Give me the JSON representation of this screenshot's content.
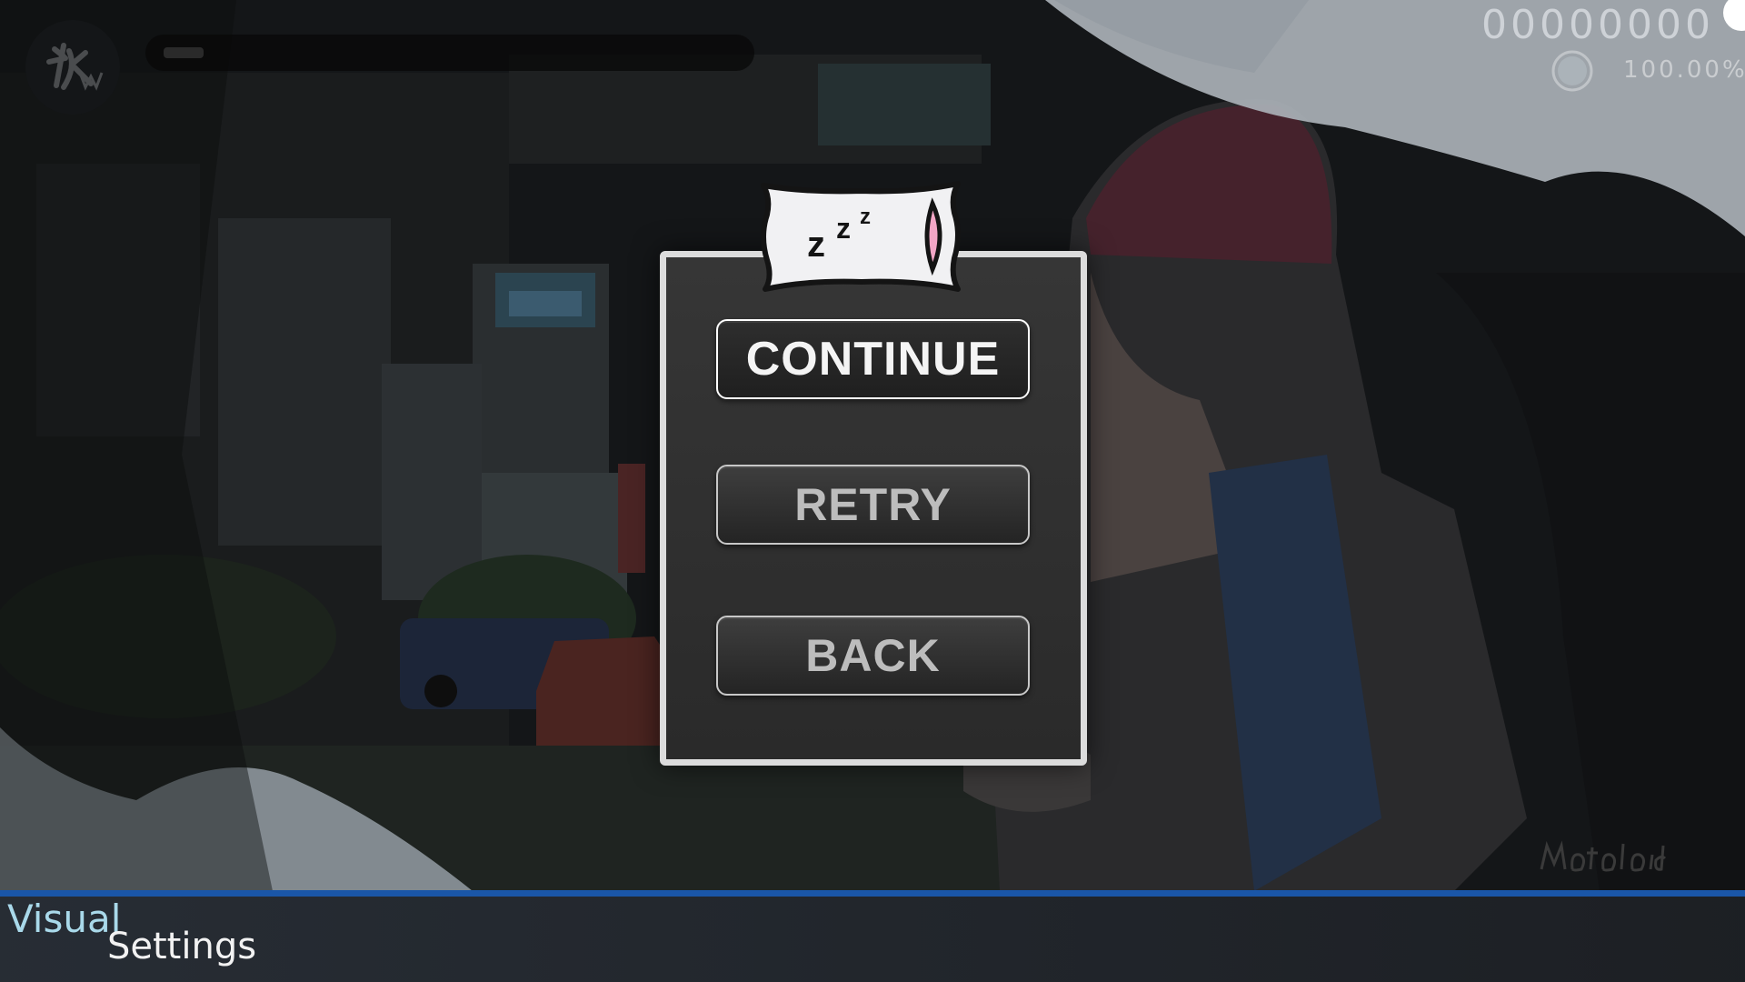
{
  "hud": {
    "logo_icon": "kw-brush-logo",
    "progress": 0.07,
    "score": "00000000",
    "accuracy": "100.00%",
    "accuracy_pie": 1.0
  },
  "pause_menu": {
    "header_icon": "sleeping-pillow-zzz-icon",
    "buttons": {
      "continue": "CONTINUE",
      "retry": "RETRY",
      "back": "BACK"
    }
  },
  "footer": {
    "visual_label": "Visual",
    "settings_label": "Settings"
  },
  "background": {
    "signature_text": "motoloid"
  },
  "colors": {
    "accent_blue": "#1a56a8",
    "visual_label": "#a9d9ea",
    "panel_border": "#dcdcdc",
    "pillow_pink": "#f2a6c6"
  }
}
